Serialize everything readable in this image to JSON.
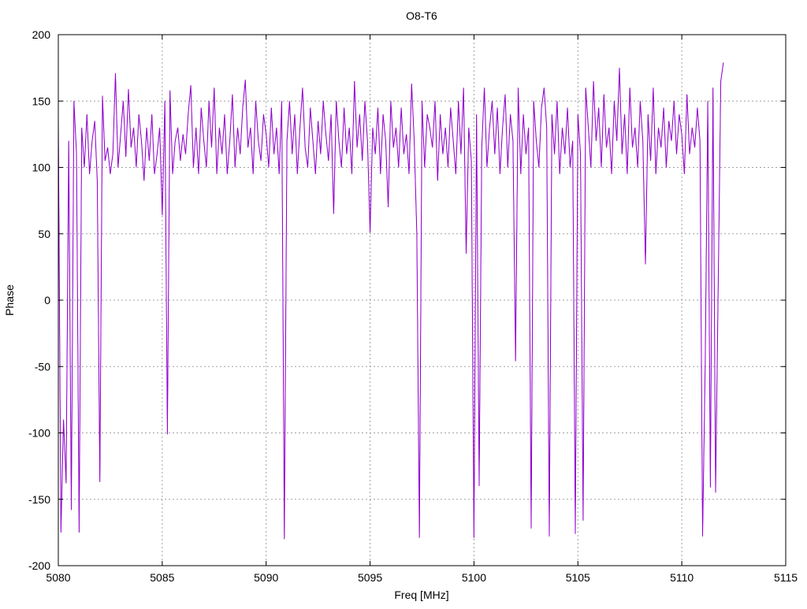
{
  "chart_data": {
    "type": "line",
    "title": "O8-T6",
    "xlabel": "Freq [MHz]",
    "ylabel": "Phase",
    "xlim": [
      5080,
      5115
    ],
    "ylim": [
      -200,
      200
    ],
    "xticks": [
      5080,
      5085,
      5090,
      5095,
      5100,
      5105,
      5110,
      5115
    ],
    "yticks": [
      -200,
      -150,
      -100,
      -50,
      0,
      50,
      100,
      150,
      200
    ],
    "grid": true,
    "x_start": 5080,
    "x_step": 0.125,
    "series": [
      {
        "name": "phase",
        "color": "#9400d3",
        "values": [
          138,
          -175,
          -90,
          -138,
          120,
          -158,
          150,
          110,
          -175,
          130,
          100,
          140,
          95,
          120,
          135,
          90,
          -137,
          154,
          105,
          115,
          95,
          110,
          171,
          100,
          125,
          150,
          108,
          159,
          115,
          130,
          100,
          140,
          120,
          90,
          130,
          105,
          140,
          95,
          110,
          130,
          64,
          150,
          -101,
          158,
          95,
          120,
          130,
          105,
          125,
          110,
          140,
          162,
          100,
          130,
          95,
          145,
          120,
          100,
          150,
          115,
          160,
          95,
          130,
          110,
          140,
          95,
          120,
          155,
          100,
          130,
          110,
          145,
          166,
          115,
          130,
          95,
          150,
          120,
          105,
          140,
          125,
          100,
          145,
          110,
          130,
          95,
          150,
          -180,
          120,
          150,
          110,
          140,
          95,
          130,
          160,
          115,
          100,
          145,
          120,
          95,
          135,
          110,
          150,
          125,
          105,
          140,
          65,
          150,
          120,
          100,
          145,
          110,
          130,
          95,
          165,
          115,
          140,
          105,
          150,
          120,
          51,
          130,
          110,
          145,
          95,
          140,
          120,
          70,
          150,
          115,
          130,
          100,
          145,
          110,
          125,
          95,
          163,
          120,
          50,
          -179,
          150,
          100,
          140,
          130,
          115,
          150,
          90,
          140,
          110,
          130,
          100,
          145,
          120,
          95,
          150,
          110,
          160,
          35,
          130,
          105,
          -179,
          140,
          -140,
          115,
          160,
          100,
          130,
          150,
          110,
          145,
          95,
          130,
          155,
          100,
          140,
          120,
          -46,
          160,
          95,
          140,
          110,
          130,
          -172,
          150,
          120,
          100,
          145,
          160,
          130,
          -178,
          140,
          110,
          150,
          95,
          130,
          110,
          145,
          100,
          120,
          -176,
          140,
          110,
          -166,
          160,
          130,
          100,
          165,
          120,
          145,
          100,
          155,
          115,
          130,
          95,
          150,
          120,
          175,
          110,
          140,
          95,
          160,
          115,
          130,
          100,
          150,
          120,
          27,
          140,
          105,
          160,
          95,
          130,
          115,
          145,
          100,
          135,
          120,
          150,
          110,
          140,
          125,
          95,
          155,
          110,
          130,
          115,
          145,
          120,
          -178,
          -50,
          150,
          -141,
          160,
          -145,
          10,
          165,
          179
        ]
      }
    ]
  }
}
